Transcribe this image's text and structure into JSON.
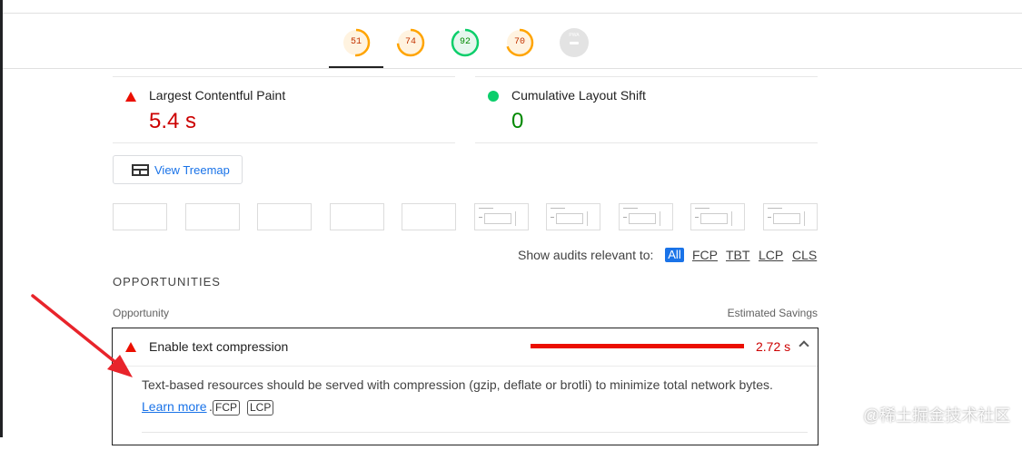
{
  "gauges": [
    {
      "score": "51",
      "color": "#ffa400",
      "fill": "#fff3e0",
      "fraction": 0.51
    },
    {
      "score": "74",
      "color": "#ffa400",
      "fill": "#fff3e0",
      "fraction": 0.74
    },
    {
      "score": "92",
      "color": "#0cce6b",
      "fill": "#e6f7ee",
      "fraction": 0.92
    },
    {
      "score": "70",
      "color": "#ffa400",
      "fill": "#fff3e0",
      "fraction": 0.7
    }
  ],
  "pwa_label": "PWA",
  "metrics": {
    "lcp": {
      "label": "Largest Contentful Paint",
      "value": "5.4 s",
      "status": "fail",
      "color": "#c00"
    },
    "cls": {
      "label": "Cumulative Layout Shift",
      "value": "0",
      "status": "pass",
      "color": "#080"
    }
  },
  "treemap_button": "View Treemap",
  "filter": {
    "label": "Show audits relevant to:",
    "options": [
      "All",
      "FCP",
      "TBT",
      "LCP",
      "CLS"
    ],
    "selected": "All"
  },
  "opportunities": {
    "section_title": "OPPORTUNITIES",
    "col_left": "Opportunity",
    "col_right": "Estimated Savings",
    "audit": {
      "title": "Enable text compression",
      "savings": "2.72 s",
      "description": "Text-based resources should be served with compression (gzip, deflate or brotli) to minimize total network bytes.",
      "learn_more": "Learn more",
      "separator": ".",
      "chips": [
        "FCP",
        "LCP"
      ]
    }
  },
  "watermark": "@稀土掘金技术社区",
  "colors": {
    "fail": "#eb0f00",
    "pass": "#0cce6b",
    "link": "#1a73e8",
    "accent": "#1a73e8"
  }
}
